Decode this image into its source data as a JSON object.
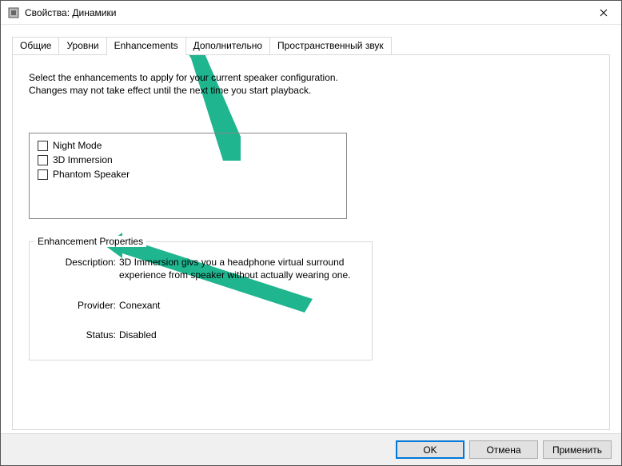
{
  "window": {
    "title": "Свойства: Динамики"
  },
  "tabs": {
    "t0": "Общие",
    "t1": "Уровни",
    "t2": "Enhancements",
    "t3": "Дополнительно",
    "t4": "Пространственный звук"
  },
  "intro": "Select the enhancements to apply for your current speaker configuration. Changes may not take effect until the next time you start playback.",
  "enhancements": {
    "e0": "Night Mode",
    "e1": "3D Immersion",
    "e2": "Phantom Speaker"
  },
  "properties": {
    "legend": "Enhancement Properties",
    "desc_label": "Description:",
    "desc_value": "3D Immersion givs you a headphone virtual surround experience from speaker without actually wearing one.",
    "provider_label": "Provider:",
    "provider_value": "Conexant",
    "status_label": "Status:",
    "status_value": "Disabled"
  },
  "buttons": {
    "ok": "OK",
    "cancel": "Отмена",
    "apply": "Применить"
  },
  "arrow_color": "#1fb58f"
}
